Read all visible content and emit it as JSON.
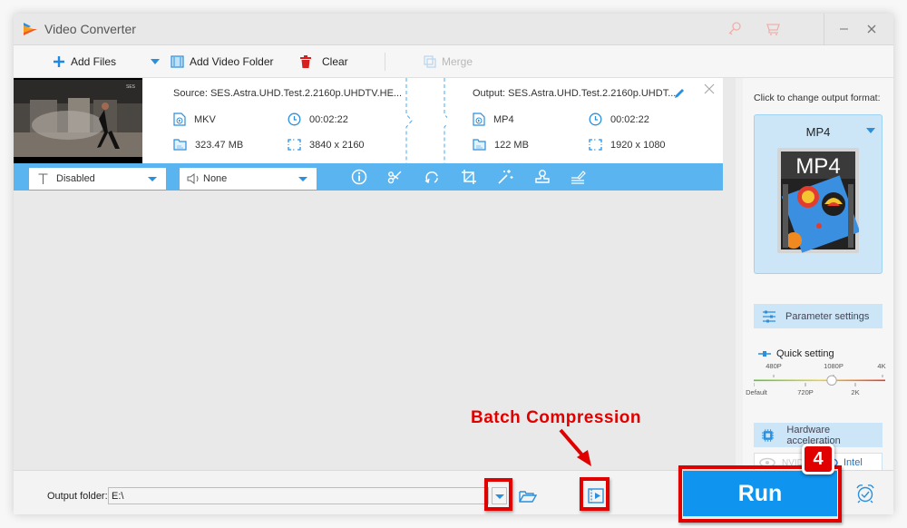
{
  "window": {
    "title": "Video Converter",
    "titlebar_icons": [
      "key-icon",
      "cart-icon",
      "minimize-icon",
      "close-icon"
    ]
  },
  "toolbar": {
    "add_files": "Add Files",
    "add_video_folder": "Add Video Folder",
    "clear": "Clear",
    "merge": "Merge"
  },
  "file": {
    "source": {
      "title": "Source: SES.Astra.UHD.Test.2.2160p.UHDTV.HE...",
      "format": "MKV",
      "duration": "00:02:22",
      "size": "323.47 MB",
      "resolution": "3840 x 2160"
    },
    "output": {
      "title": "Output: SES.Astra.UHD.Test.2.2160p.UHDT...",
      "format": "MP4",
      "duration": "00:02:22",
      "size": "122 MB",
      "resolution": "1920 x 1080"
    },
    "subtitle_select": "Disabled",
    "audio_select": "None",
    "edit_tools": [
      "info-icon",
      "scissors-icon",
      "rotate-icon",
      "crop-icon",
      "effects-wand-icon",
      "watermark-stamp-icon",
      "subtitle-edit-icon"
    ]
  },
  "right_panel": {
    "change_format_label": "Click to change output format:",
    "format_name": "MP4",
    "format_icon_text": "MP4",
    "parameter_settings": "Parameter settings",
    "quick_setting": "Quick setting",
    "quality_levels_top": [
      "480P",
      "1080P",
      "4K"
    ],
    "quality_levels_bottom": [
      "Default",
      "720P",
      "2K"
    ],
    "quality_selected": "1080P",
    "hardware_acceleration": "Hardware acceleration",
    "gpu_nvidia": "NVIDIA",
    "gpu_intel": "Intel"
  },
  "bottom": {
    "output_folder_label": "Output folder:",
    "output_folder_value": "E:\\",
    "run": "Run"
  },
  "annotations": {
    "callout_text": "Batch Compression",
    "step_number": "4",
    "highlight_color": "#e00000"
  },
  "colors": {
    "accent_blue": "#0f95ef",
    "bar_blue": "#5ab4f0",
    "panel_blue": "#cce6f7"
  }
}
